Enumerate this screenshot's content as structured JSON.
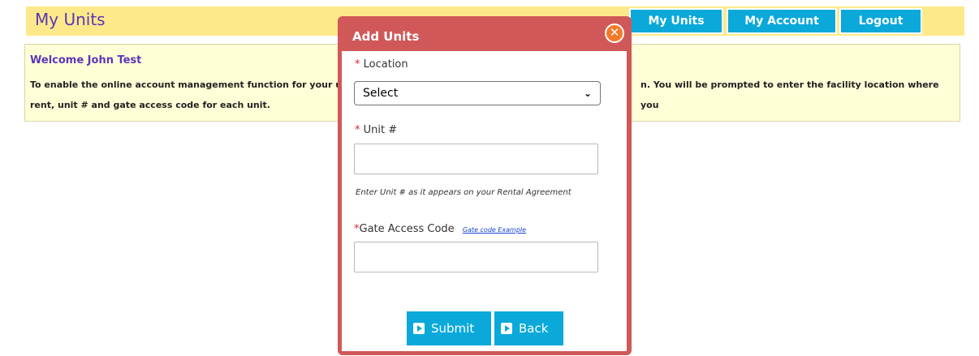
{
  "header": {
    "title": "My Units",
    "nav": [
      {
        "label": "My Units"
      },
      {
        "label": "My Account"
      },
      {
        "label": "Logout"
      }
    ]
  },
  "welcome": {
    "title": "Welcome John Test",
    "text_line1_left": "To enable the online account management function for your u",
    "text_line1_right": "n. You will be prompted to enter the facility location where you",
    "text_line2": "rent, unit # and gate access code for each unit."
  },
  "modal": {
    "title": "Add Units",
    "close_symbol": "✕",
    "location_label": "Location",
    "location_value": "Select",
    "unit_label": "Unit #",
    "unit_value": "",
    "unit_hint": "Enter Unit # as it appears on your Rental Agreement",
    "gate_label": "Gate Access Code",
    "gate_link": "Gate code Example",
    "gate_value": "",
    "required_marker": "*",
    "submit_label": "Submit",
    "back_label": "Back"
  },
  "colors": {
    "header_band": "#fde98a",
    "nav_button": "#0aa9da",
    "modal_frame": "#d05858",
    "close_button": "#f47a2a",
    "welcome_bg": "#ffffd7"
  }
}
